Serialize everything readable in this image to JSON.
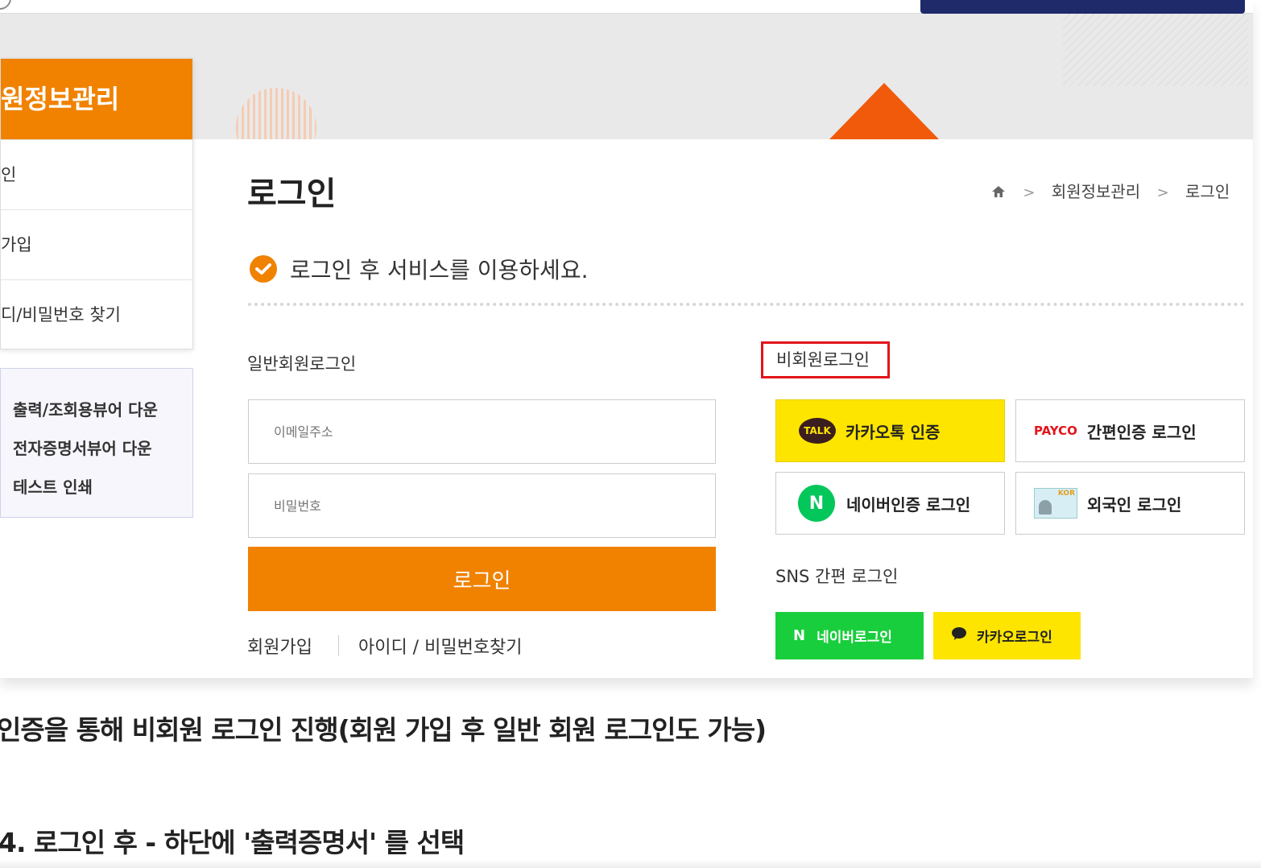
{
  "sidebar": {
    "title": "원정보관리",
    "items": [
      {
        "label": "인"
      },
      {
        "label": "가입"
      },
      {
        "label": "디/비밀번호 찾기"
      }
    ],
    "downloads": [
      {
        "label": "출력/조회용뷰어 다운"
      },
      {
        "label": "전자증명서뷰어 다운"
      },
      {
        "label": "테스트 인쇄"
      }
    ]
  },
  "main": {
    "page_title": "로그인",
    "breadcrumb": {
      "sep": ">",
      "section": "회원정보관리",
      "current": "로그인"
    },
    "notice": "로그인 후 서비스를 이용하세요.",
    "general_login": {
      "label": "일반회원로그인",
      "email_placeholder": "이메일주소",
      "password_placeholder": "비밀번호",
      "login_button": "로그인",
      "signup_link": "회원가입",
      "find_link": "아이디 / 비밀번호찾기"
    },
    "nonmember_login": {
      "label": "비회원로그인",
      "kakao": {
        "icon_text": "TALK",
        "label": "카카오톡 인증"
      },
      "payco": {
        "icon_text": "PAYCO",
        "label": "간편인증 로그인"
      },
      "naver": {
        "icon_text": "N",
        "label": "네이버인증 로그인"
      },
      "foreigner": {
        "icon_text": "KOR",
        "label": "외국인 로그인"
      }
    },
    "sns_login": {
      "label": "SNS 간편 로그인",
      "naver": {
        "icon_text": "N",
        "label": "네이버로그인"
      },
      "kakao": {
        "label": "카카오로그인"
      }
    }
  },
  "captions": {
    "line1": "인증을 통해 비회원 로그인 진행(회원 가입 후 일반 회원 로그인도 가능)",
    "line2": "4. 로그인 후 - 하단에 '출력증명서' 를 선택"
  },
  "colors": {
    "accent": "#f08200",
    "highlight_box": "#e3141b",
    "kakao": "#fee500",
    "naver": "#19ce3c",
    "navy": "#1f2a6b"
  }
}
